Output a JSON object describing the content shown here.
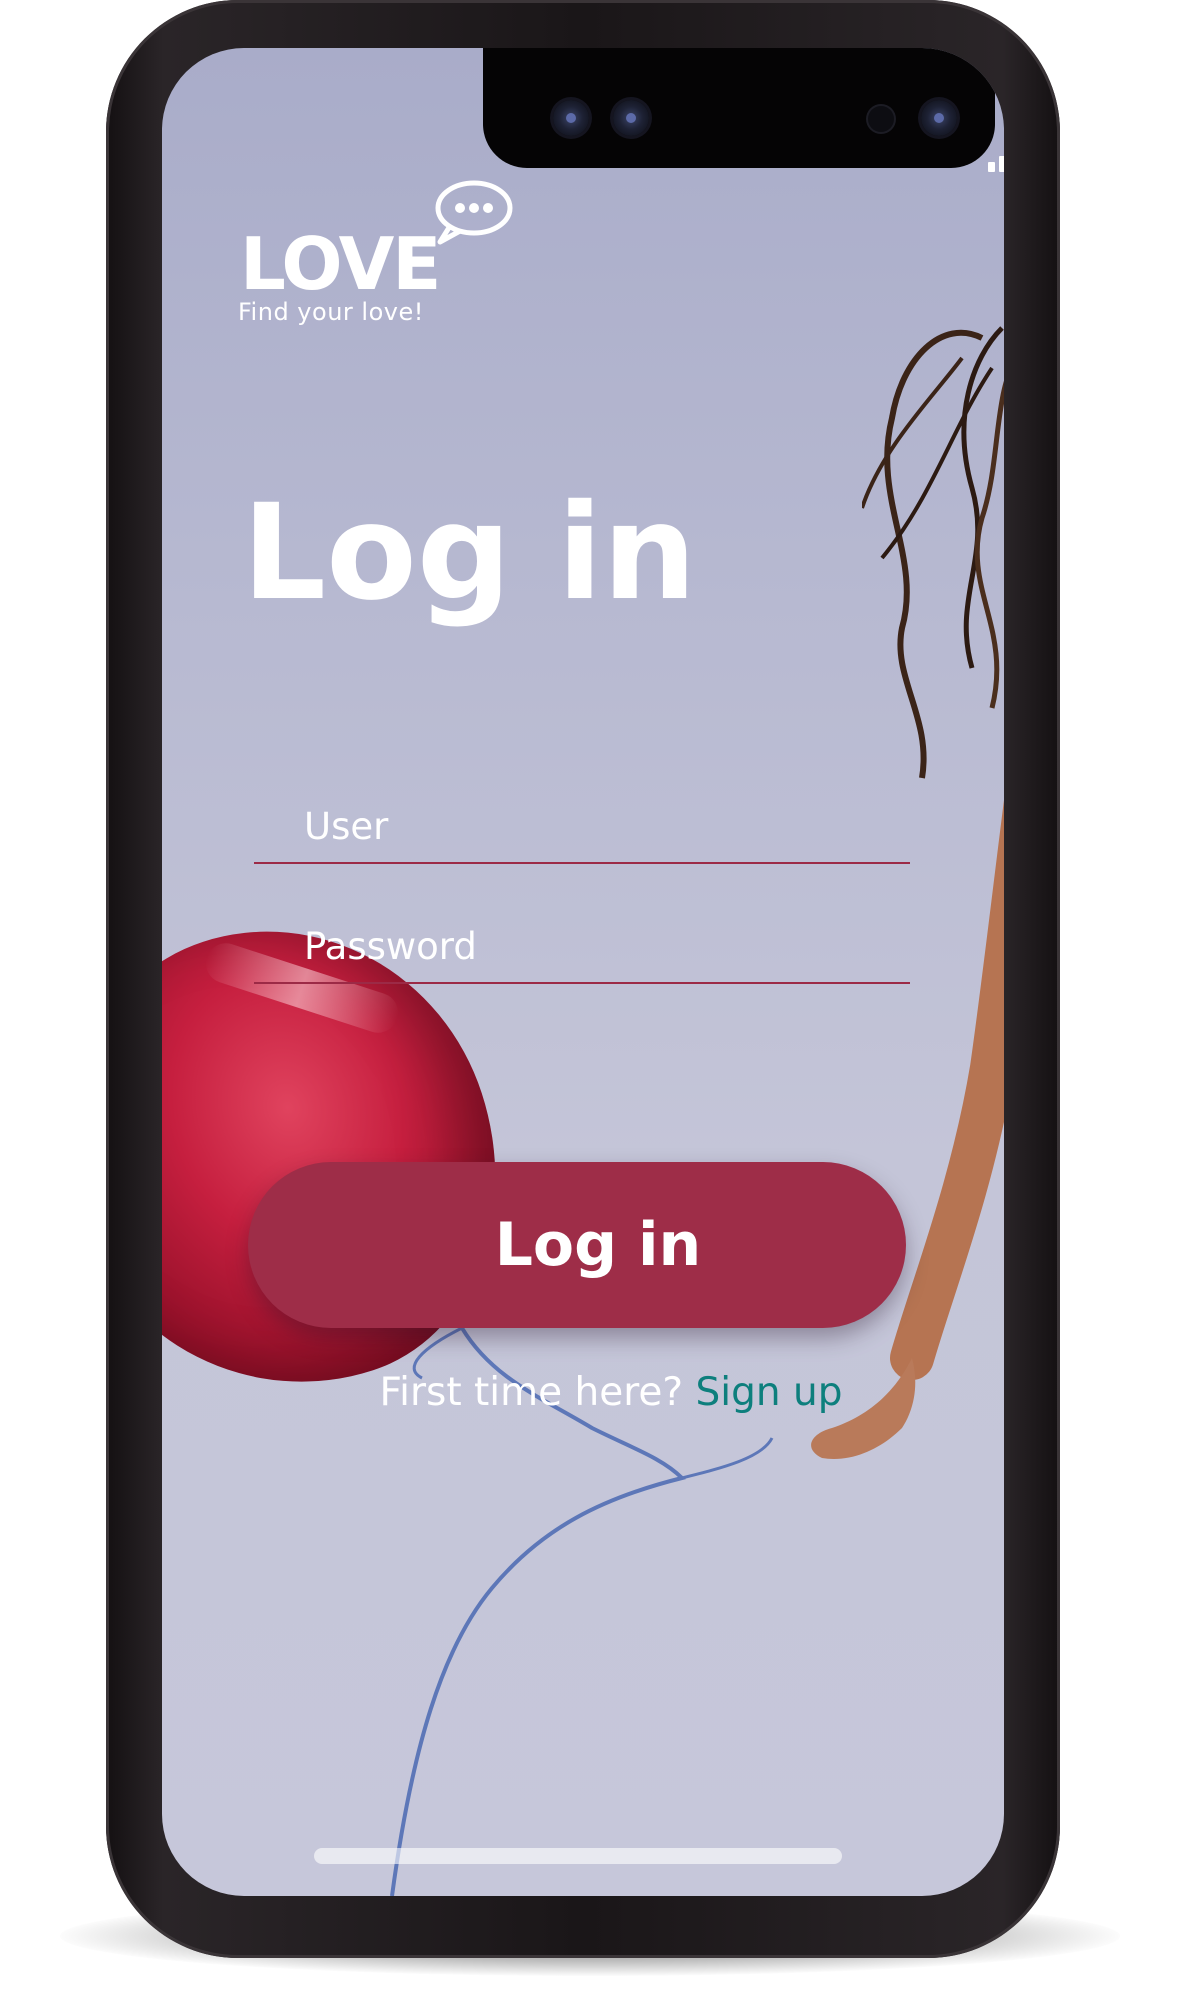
{
  "app": {
    "logo_text": "LOVE",
    "tagline": "Find your love!"
  },
  "login": {
    "title": "Log in",
    "user_placeholder": "User",
    "password_placeholder": "Password",
    "button_label": "Log in",
    "signup_prompt": "First time here?",
    "signup_link": "Sign up"
  },
  "colors": {
    "brand": "#9e2d48",
    "link": "#0d7f7d",
    "text": "#ffffff"
  },
  "icons": [
    "chat-bubble-icon",
    "signal-icon",
    "wifi-icon",
    "battery-icon"
  ]
}
